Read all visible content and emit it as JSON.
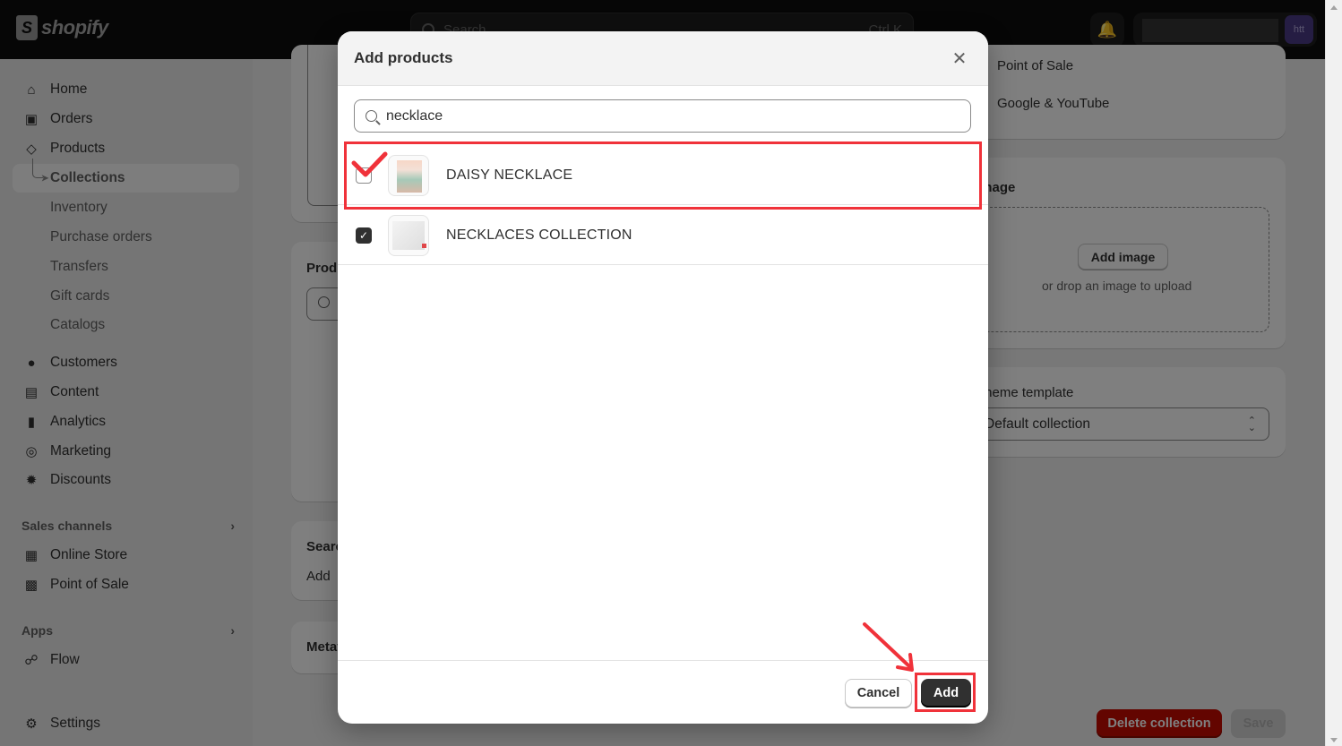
{
  "topbar": {
    "brand": "shopify",
    "search_placeholder": "Search",
    "search_shortcut": "Ctrl K",
    "avatar_initials": "htt"
  },
  "sidebar": {
    "items": [
      {
        "label": "Home",
        "icon": "home-icon"
      },
      {
        "label": "Orders",
        "icon": "inbox-icon"
      },
      {
        "label": "Products",
        "icon": "tag-icon"
      },
      {
        "label": "Collections",
        "active": true
      },
      {
        "label": "Inventory"
      },
      {
        "label": "Purchase orders"
      },
      {
        "label": "Transfers"
      },
      {
        "label": "Gift cards"
      },
      {
        "label": "Catalogs"
      },
      {
        "label": "Customers",
        "icon": "person-icon"
      },
      {
        "label": "Content",
        "icon": "content-icon"
      },
      {
        "label": "Analytics",
        "icon": "bar-chart-icon"
      },
      {
        "label": "Marketing",
        "icon": "target-icon"
      },
      {
        "label": "Discounts",
        "icon": "discount-icon"
      }
    ],
    "sales_channels": {
      "heading": "Sales channels",
      "items": [
        {
          "label": "Online Store",
          "icon": "store-icon"
        },
        {
          "label": "Point of Sale",
          "icon": "pos-icon"
        }
      ]
    },
    "apps": {
      "heading": "Apps",
      "items": [
        {
          "label": "Flow",
          "icon": "flow-icon"
        }
      ]
    },
    "settings_label": "Settings"
  },
  "background": {
    "channels": [
      "Point of Sale",
      "Google & YouTube"
    ],
    "image_card_title": "Image",
    "add_image_label": "Add image",
    "drop_hint": "or drop an image to upload",
    "theme_template_label": "Theme template",
    "theme_template_value": "Default collection",
    "products_card_title": "Products",
    "seo_card_title": "Search engine listing",
    "seo_card_text": "Add",
    "metafields_card_title": "Metafields",
    "delete_label": "Delete collection",
    "save_label": "Save"
  },
  "modal": {
    "title": "Add products",
    "search_value": "necklace",
    "results": [
      {
        "label": "DAISY NECKLACE",
        "checked": false
      },
      {
        "label": "NECKLACES COLLECTION",
        "checked": true
      }
    ],
    "cancel_label": "Cancel",
    "add_label": "Add"
  },
  "colors": {
    "annotation": "#f0323a",
    "danger": "#c70a00",
    "primary_button": "#303030",
    "avatar_bg": "#4a3a86"
  }
}
